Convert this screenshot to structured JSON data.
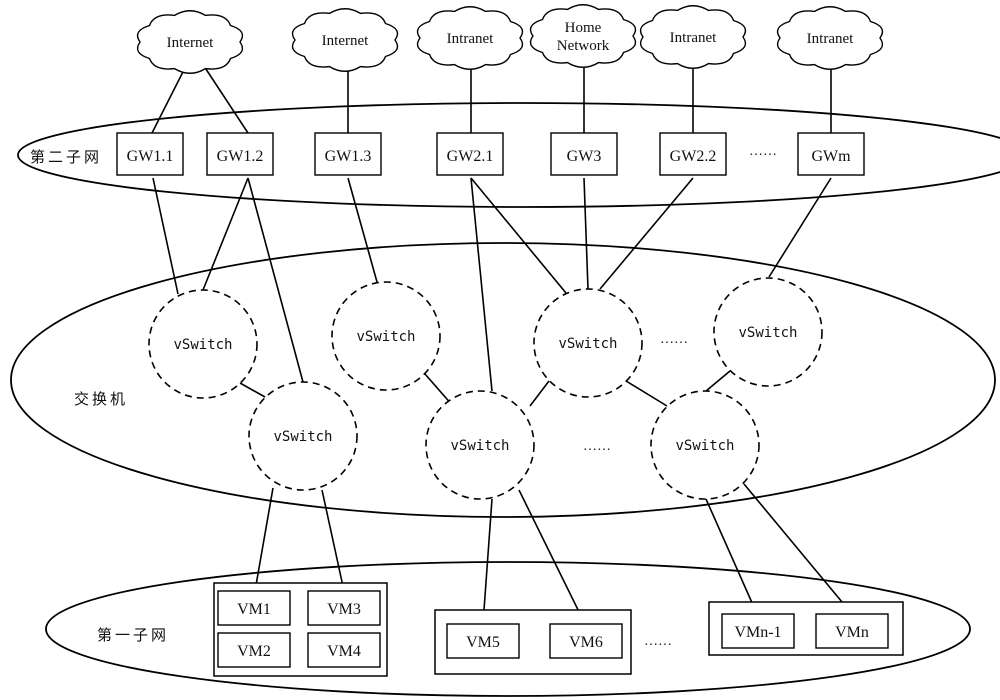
{
  "diagram": {
    "regions": {
      "second_subnet": "第二子网",
      "switch_layer": "交换机",
      "first_subnet": "第一子网"
    },
    "clouds": [
      {
        "id": "c1",
        "label": "Internet"
      },
      {
        "id": "c2",
        "label": "Internet"
      },
      {
        "id": "c3",
        "label": "Intranet"
      },
      {
        "id": "c4",
        "label": "Home Network",
        "lines": [
          "Home",
          "Network"
        ]
      },
      {
        "id": "c5",
        "label": "Intranet"
      },
      {
        "id": "c6",
        "label": "Intranet"
      }
    ],
    "gateways": [
      {
        "id": "gw11",
        "label": "GW1.1"
      },
      {
        "id": "gw12",
        "label": "GW1.2"
      },
      {
        "id": "gw13",
        "label": "GW1.3"
      },
      {
        "id": "gw21",
        "label": "GW2.1"
      },
      {
        "id": "gw3",
        "label": "GW3"
      },
      {
        "id": "gw22",
        "label": "GW2.2"
      },
      {
        "id": "gwm",
        "label": "GWm"
      }
    ],
    "vswitches": [
      {
        "id": "vs1",
        "label": "vSwitch"
      },
      {
        "id": "vs2",
        "label": "vSwitch"
      },
      {
        "id": "vs3",
        "label": "vSwitch"
      },
      {
        "id": "vs4",
        "label": "vSwitch"
      },
      {
        "id": "vs5",
        "label": "vSwitch"
      },
      {
        "id": "vs6",
        "label": "vSwitch"
      },
      {
        "id": "vs7",
        "label": "vSwitch"
      }
    ],
    "vm_groups": [
      {
        "id": "g1",
        "vms": [
          "VM1",
          "VM3",
          "VM2",
          "VM4"
        ]
      },
      {
        "id": "g2",
        "vms": [
          "VM5",
          "VM6"
        ]
      },
      {
        "id": "g3",
        "vms": [
          "VMn-1",
          "VMn"
        ]
      }
    ],
    "ellipsis": "……",
    "edges": [
      [
        "c1",
        "gw11"
      ],
      [
        "c1",
        "gw12"
      ],
      [
        "c2",
        "gw13"
      ],
      [
        "c3",
        "gw21"
      ],
      [
        "c4",
        "gw3"
      ],
      [
        "c5",
        "gw22"
      ],
      [
        "c6",
        "gwm"
      ],
      [
        "gw11",
        "vs1"
      ],
      [
        "gw12",
        "vs1"
      ],
      [
        "gw12",
        "vs2"
      ],
      [
        "gw13",
        "vs3"
      ],
      [
        "gw21",
        "vs4"
      ],
      [
        "gw21",
        "vs5"
      ],
      [
        "gw3",
        "vs5"
      ],
      [
        "gw22",
        "vs5"
      ],
      [
        "gwm",
        "vs6"
      ],
      [
        "vs1",
        "vs2"
      ],
      [
        "vs3",
        "vs4"
      ],
      [
        "vs5",
        "vs4"
      ],
      [
        "vs5",
        "vs7"
      ],
      [
        "vs6",
        "vs7"
      ],
      [
        "vs2",
        "VM1"
      ],
      [
        "vs2",
        "VM3"
      ],
      [
        "vs4",
        "VM5"
      ],
      [
        "vs4",
        "VM6"
      ],
      [
        "vs7",
        "VMn-1"
      ],
      [
        "vs7",
        "VMn"
      ]
    ]
  }
}
